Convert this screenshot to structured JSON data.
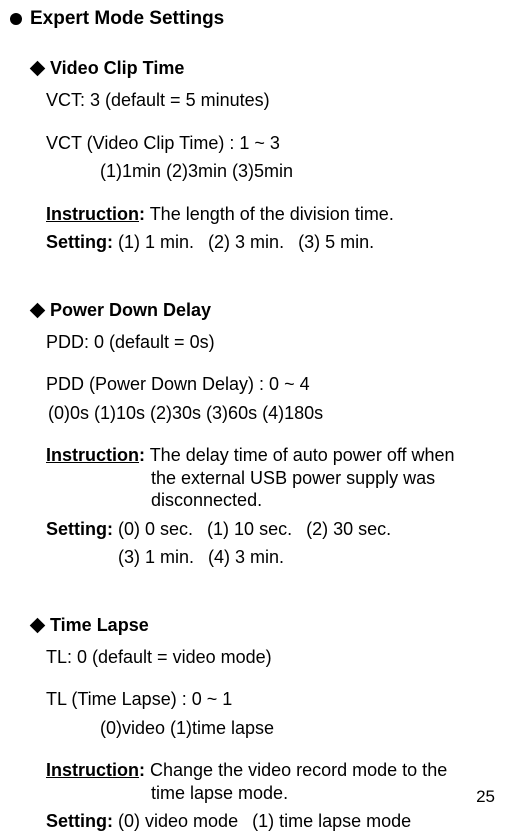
{
  "page": {
    "title": "Expert Mode Settings",
    "number": "25"
  },
  "sections": [
    {
      "heading": "Video Clip Time",
      "current": "VCT: 3 (default = 5 minutes)",
      "desc_l1": "VCT (Video Clip Time) : 1 ~ 3",
      "desc_l2": "(1)1min (2)3min (3)5min",
      "instruction_label": "Instruction",
      "instruction_text": "The length of the division time.",
      "setting_label": "Setting:",
      "opts": [
        "(1) 1 min.",
        "(2) 3 min.",
        "(3) 5 min."
      ]
    },
    {
      "heading": "Power Down Delay",
      "current": "PDD: 0 (default = 0s)",
      "desc_l1": "PDD (Power Down Delay) : 0 ~ 4",
      "desc_l2": "(0)0s (1)10s (2)30s (3)60s (4)180s",
      "instruction_label": "Instruction",
      "instruction_text_l1": "The delay time of auto power off when",
      "instruction_text_l2": "the external USB power supply was disconnected.",
      "setting_label": "Setting:",
      "opts_l1": [
        "(0) 0 sec.",
        "(1) 10 sec.",
        "(2) 30 sec."
      ],
      "opts_l2": [
        "(3) 1 min.",
        "(4) 3 min."
      ]
    },
    {
      "heading": "Time Lapse",
      "current": "TL: 0 (default = video mode)",
      "desc_l1": "TL (Time Lapse) : 0 ~ 1",
      "desc_l2": "(0)video (1)time lapse",
      "instruction_label": "Instruction",
      "instruction_text_l1": "Change the video record mode to the",
      "instruction_text_l2": "time lapse mode.",
      "setting_label": "Setting:",
      "opts": [
        "(0) video mode",
        "(1) time lapse mode"
      ]
    }
  ]
}
